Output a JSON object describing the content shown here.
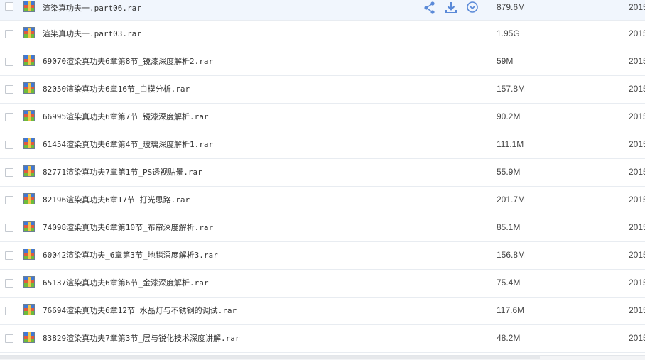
{
  "colors": {
    "row_hover_bg": "#f1f6fd",
    "action_icon": "#5b8ad8",
    "divider": "#e8ecf1"
  },
  "row_actions": {
    "share_icon": "share-icon",
    "download_icon": "download-icon",
    "more_icon": "chevron-down-circle-icon"
  },
  "files": [
    {
      "name": "渲染真功夫一.part06.rar",
      "size": "879.6M",
      "date": "2015",
      "hovered": true
    },
    {
      "name": "渲染真功夫一.part03.rar",
      "size": "1.95G",
      "date": "2015"
    },
    {
      "name": "69070渲染真功夫6章第8节_镜漆深度解析2.rar",
      "size": "59M",
      "date": "2015"
    },
    {
      "name": "82050渲染真功夫6章16节_白模分析.rar",
      "size": "157.8M",
      "date": "2015"
    },
    {
      "name": "66995渲染真功夫6章第7节_镜漆深度解析.rar",
      "size": "90.2M",
      "date": "2015"
    },
    {
      "name": "61454渲染真功夫6章第4节_玻璃深度解析1.rar",
      "size": "111.1M",
      "date": "2015"
    },
    {
      "name": "82771渲染真功夫7章第1节_PS透视贴景.rar",
      "size": "55.9M",
      "date": "2015"
    },
    {
      "name": "82196渲染真功夫6章17节_打光思路.rar",
      "size": "201.7M",
      "date": "2015"
    },
    {
      "name": "74098渲染真功夫6章第10节_布帘深度解析.rar",
      "size": "85.1M",
      "date": "2015"
    },
    {
      "name": "60042渲染真功夫_6章第3节_地毯深度解析3.rar",
      "size": "156.8M",
      "date": "2015"
    },
    {
      "name": "65137渲染真功夫6章第6节_金漆深度解析.rar",
      "size": "75.4M",
      "date": "2015"
    },
    {
      "name": "76694渲染真功夫6章12节_水晶灯与不锈钢的调试.rar",
      "size": "117.6M",
      "date": "2015"
    },
    {
      "name": "83829渲染真功夫7章第3节_层与锐化技术深度讲解.rar",
      "size": "48.2M",
      "date": "2015"
    }
  ]
}
